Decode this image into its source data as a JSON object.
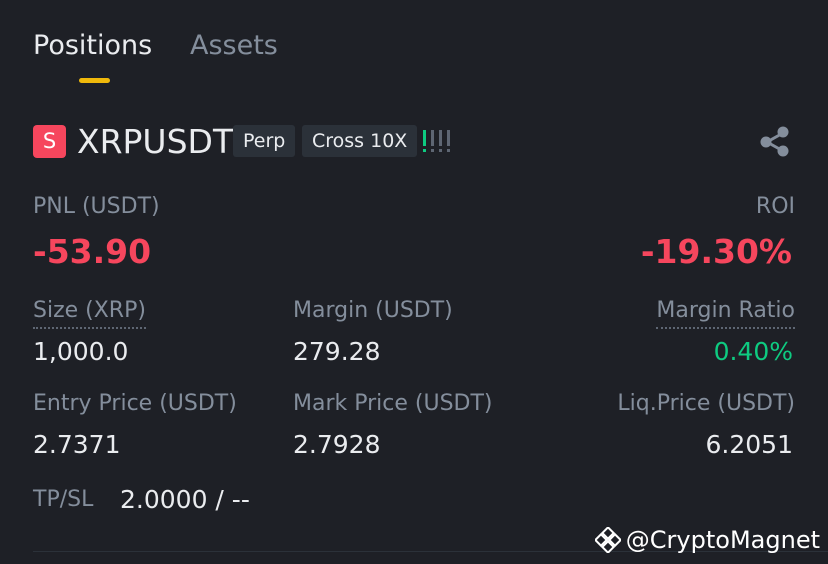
{
  "tabs": {
    "active": "Positions",
    "inactive": "Assets"
  },
  "position": {
    "side_badge": "S",
    "symbol": "XRPUSDT",
    "tag_type": "Perp",
    "tag_margin": "Cross 10X",
    "pnl_label": "PNL (USDT)",
    "pnl_value": "-53.90",
    "roi_label": "ROI",
    "roi_value": "-19.30%",
    "size_label": "Size (XRP)",
    "size_value": "1,000.0",
    "margin_label": "Margin (USDT)",
    "margin_value": "279.28",
    "margin_ratio_label": "Margin Ratio",
    "margin_ratio_value": "0.40%",
    "entry_label": "Entry Price (USDT)",
    "entry_value": "2.7371",
    "mark_label": "Mark Price (USDT)",
    "mark_value": "2.7928",
    "liq_label": "Liq.Price (USDT)",
    "liq_value": "6.2051",
    "tpsl_label": "TP/SL",
    "tpsl_value": "2.0000 / --"
  },
  "colors": {
    "background": "#1e2026",
    "accent": "#f0b90b",
    "loss": "#f6465d",
    "profit": "#0ecb81",
    "muted": "#848e9c"
  },
  "icons": {
    "share": "share-icon",
    "adl": "adl-indicator-icon",
    "watermark_logo": "binance-logo-icon"
  },
  "watermark": "@CryptoMagnet"
}
